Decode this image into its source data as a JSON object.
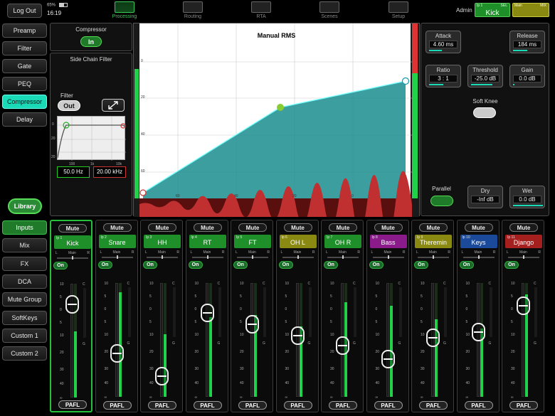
{
  "topbar": {
    "logout": "Log Out",
    "battery": "65%",
    "time": "16:19",
    "tabs": [
      {
        "label": "Processing",
        "icon": "eq-curve-icon",
        "active": true
      },
      {
        "label": "Routing",
        "icon": "routing-icon",
        "active": false
      },
      {
        "label": "RTA",
        "icon": "rta-icon",
        "active": false
      },
      {
        "label": "Scenes",
        "icon": "scenes-icon",
        "active": false
      },
      {
        "label": "Setup",
        "icon": "gear-icon",
        "active": false
      }
    ],
    "user": "Admin",
    "selected_channel": {
      "ip": "Ip 1",
      "tag": "SEL",
      "name": "Kick"
    },
    "mix_box": {
      "name": "Main",
      "tag": "MIX"
    }
  },
  "proc_menu": [
    "Preamp",
    "Filter",
    "Gate",
    "PEQ",
    "Compressor",
    "Delay"
  ],
  "proc_active": "Compressor",
  "library": "Library",
  "nav_menu": [
    "Inputs",
    "Mix",
    "FX",
    "DCA",
    "Mute Group",
    "SoftKeys",
    "Custom 1",
    "Custom 2"
  ],
  "nav_active": "Inputs",
  "compressor": {
    "title": "Compressor",
    "in_label": "In",
    "sidechain_title": "Side Chain Filter",
    "filter_label": "Filter",
    "filter_state": "Out",
    "sc_axis_y": [
      "0",
      "20"
    ],
    "sc_axis_x": [
      "20",
      "100",
      "1k",
      "10k"
    ],
    "hpf": "50.0 Hz",
    "lpf": "20.00 kHz",
    "graph_title": "Manual RMS",
    "graph_y": [
      "0",
      "20",
      "40",
      "60"
    ],
    "graph_x": [
      "60",
      "40",
      "20",
      "0"
    ],
    "attack": {
      "label": "Attack",
      "value": "4.60 ms"
    },
    "release": {
      "label": "Release",
      "value": "184 ms"
    },
    "ratio": {
      "label": "Ratio",
      "value": "3 : 1"
    },
    "threshold": {
      "label": "Threshold",
      "value": "-25.0 dB"
    },
    "gain": {
      "label": "Gain",
      "value": "0.0 dB"
    },
    "soft_knee": "Soft Knee",
    "parallel": "Parallel",
    "dry": {
      "label": "Dry",
      "value": "-Inf dB"
    },
    "wet": {
      "label": "Wet",
      "value": "0.0 dB"
    }
  },
  "strip_labels": {
    "mute": "Mute",
    "on": "On",
    "pafl": "PAFL",
    "main": "Main",
    "l": "L",
    "r": "R",
    "c": "C",
    "g": "G"
  },
  "fader_scale": [
    "10",
    "5",
    "0",
    "5",
    "10",
    "20",
    "30",
    "40",
    "∞"
  ],
  "channels": [
    {
      "ip": "Ip 1",
      "name": "Kick",
      "color": "#1f8f2a",
      "fader": 0.82,
      "meter": 0.58,
      "selected": true
    },
    {
      "ip": "Ip 2",
      "name": "Snare",
      "color": "#1f8f2a",
      "fader": 0.38,
      "meter": 0.92,
      "selected": false
    },
    {
      "ip": "Ip 3",
      "name": "HH",
      "color": "#1f8f2a",
      "fader": 0.18,
      "meter": 0.55,
      "selected": false
    },
    {
      "ip": "Ip 4",
      "name": "RT",
      "color": "#1f8f2a",
      "fader": 0.74,
      "meter": 0.7,
      "selected": false
    },
    {
      "ip": "Ip 5",
      "name": "FT",
      "color": "#1f8f2a",
      "fader": 0.64,
      "meter": 0.72,
      "selected": false
    },
    {
      "ip": "Ip 6",
      "name": "OH L",
      "color": "#8a8a12",
      "fader": 0.54,
      "meter": 0.62,
      "selected": false
    },
    {
      "ip": "Ip 7",
      "name": "OH R",
      "color": "#1f8f2a",
      "fader": 0.45,
      "meter": 0.83,
      "selected": false
    },
    {
      "ip": "Ip 8",
      "name": "Bass",
      "color": "#8b1a8b",
      "fader": 0.33,
      "meter": 0.8,
      "selected": false
    },
    {
      "ip": "Ip 9",
      "name": "Theremin",
      "color": "#8a8a12",
      "fader": 0.52,
      "meter": 0.68,
      "selected": false
    },
    {
      "ip": "Ip 10",
      "name": "Keys",
      "color": "#1b4a9a",
      "fader": 0.57,
      "meter": 0.6,
      "selected": false
    },
    {
      "ip": "Ip 11",
      "name": "Django",
      "color": "#a51f1f",
      "fader": 0.8,
      "meter": 0.9,
      "selected": false
    }
  ]
}
